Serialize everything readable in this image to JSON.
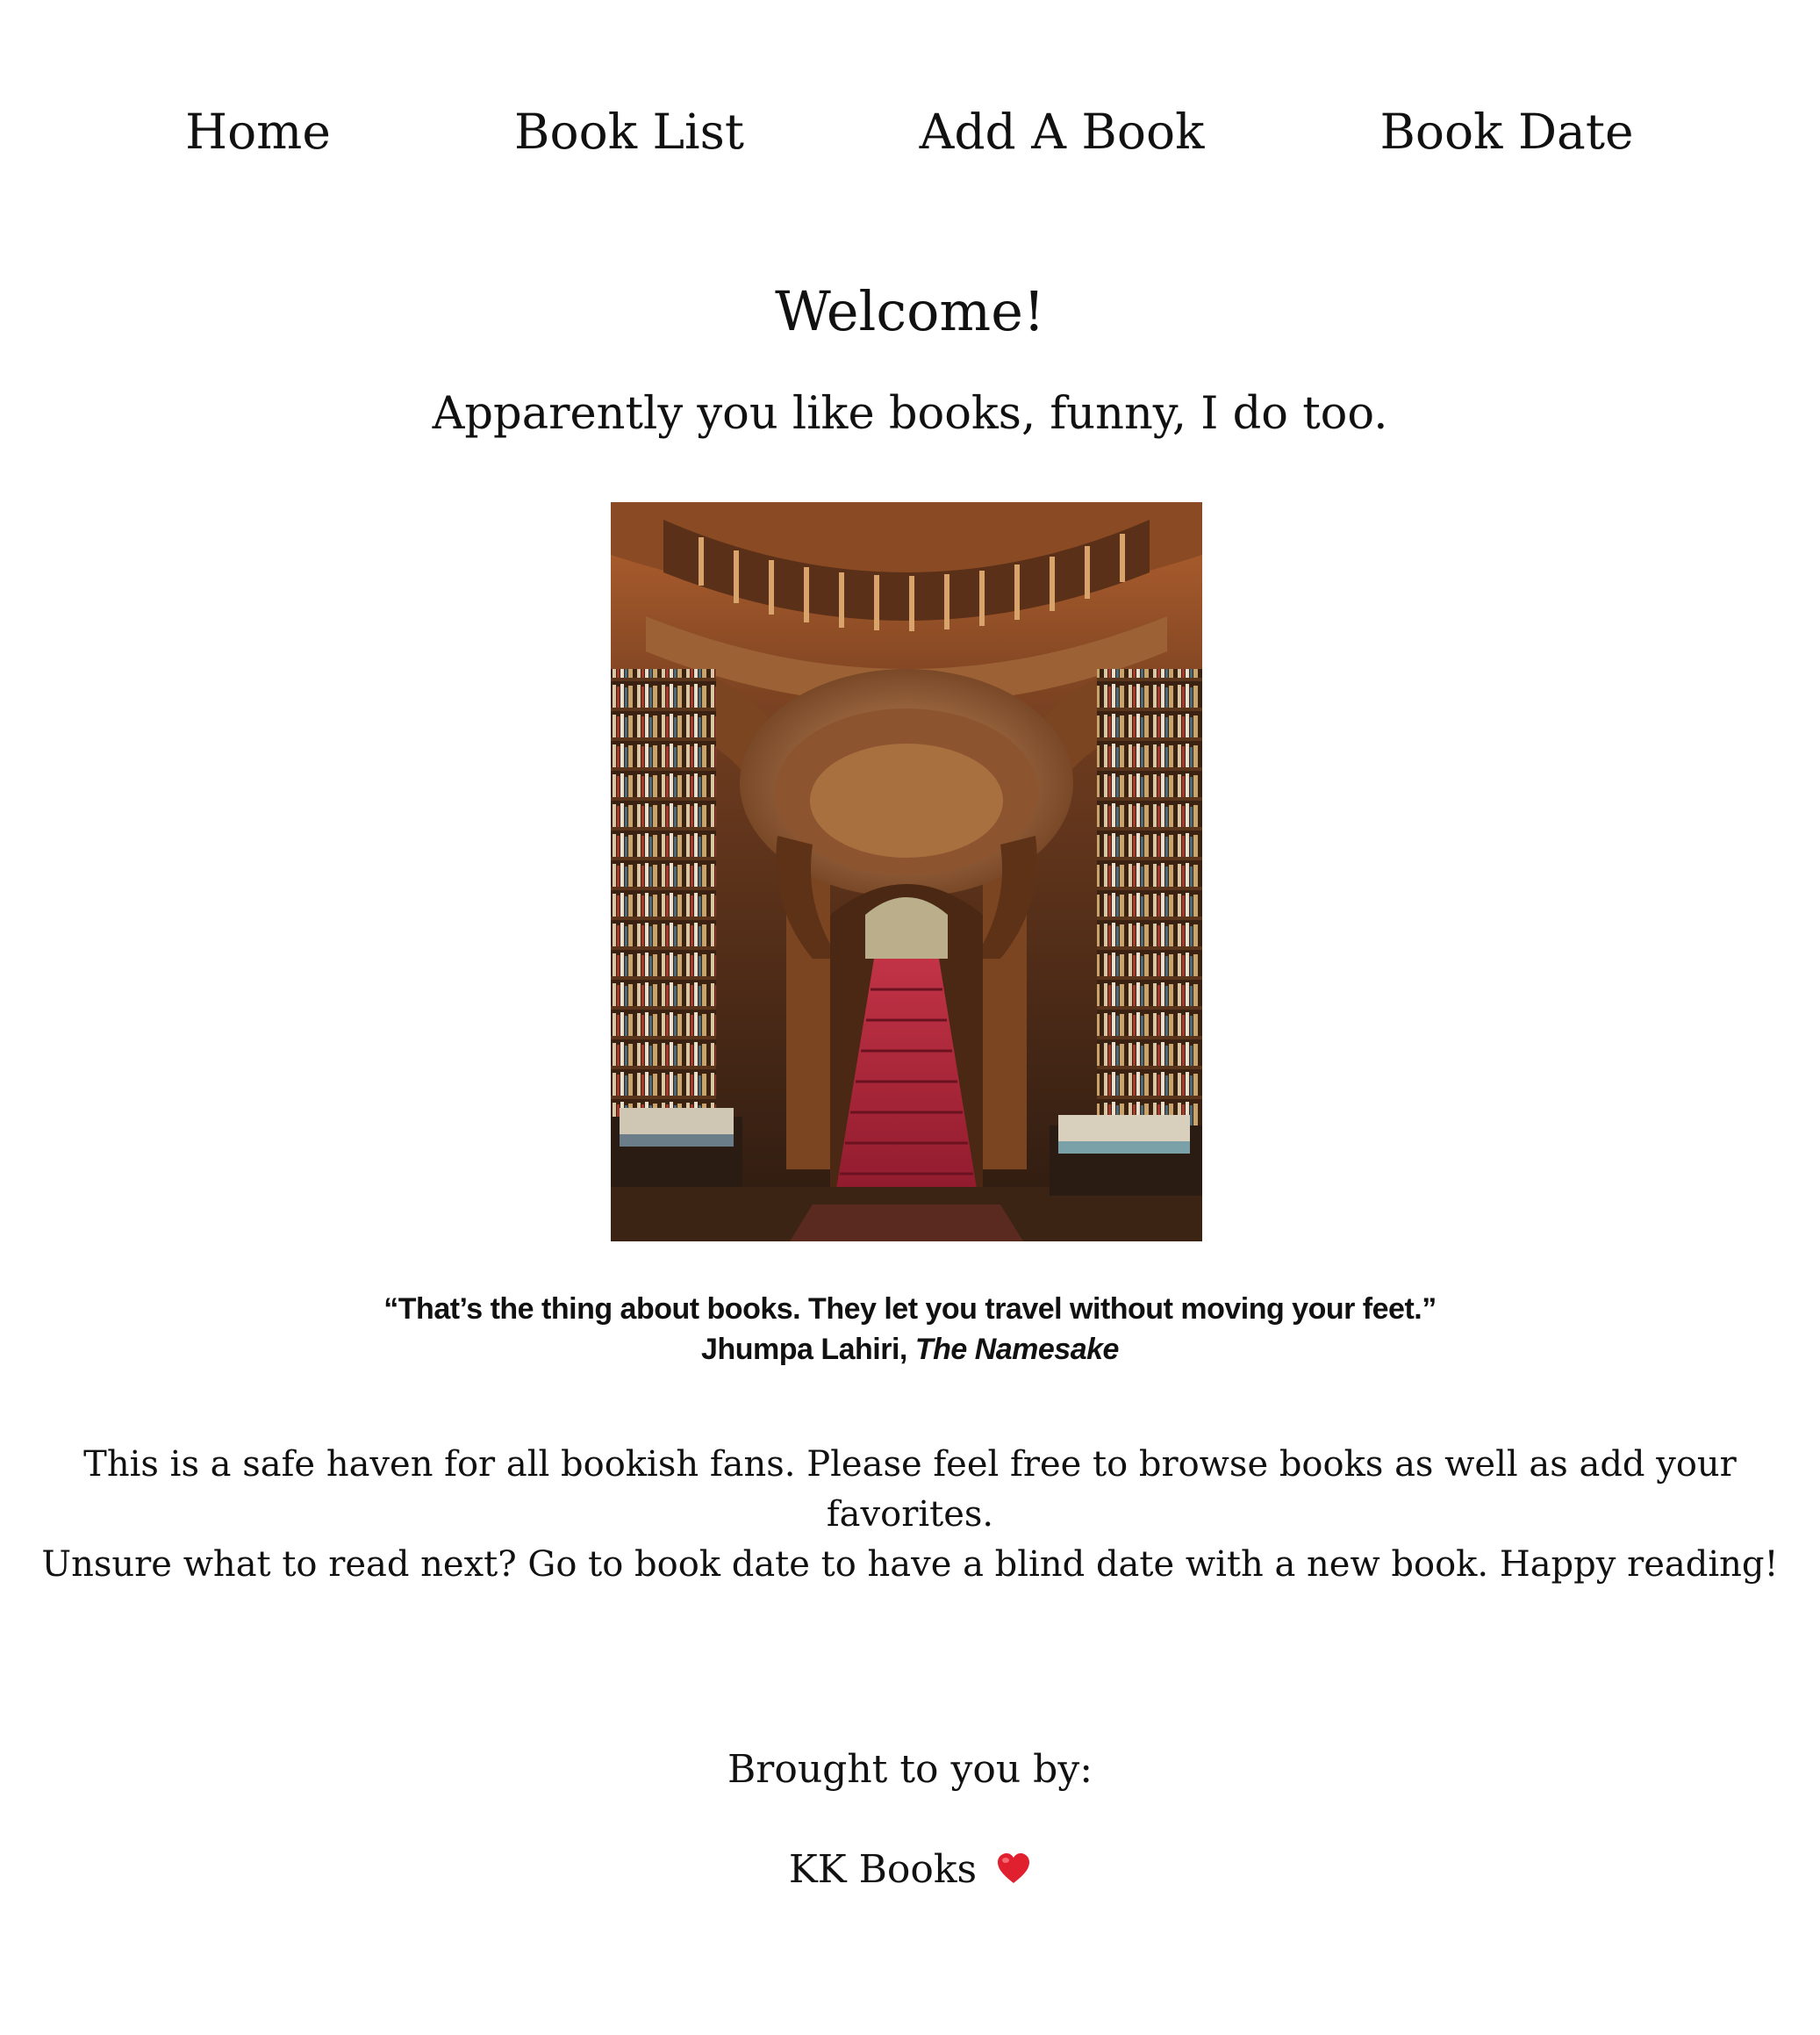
{
  "nav": {
    "items": [
      {
        "label": "Home"
      },
      {
        "label": "Book List"
      },
      {
        "label": "Add A Book"
      },
      {
        "label": "Book Date"
      }
    ]
  },
  "hero": {
    "title": "Welcome!",
    "subtitle": "Apparently you like books, funny, I do too."
  },
  "image": {
    "icon": "bookstore-staircase-photo"
  },
  "quote": {
    "text": "“That’s the thing about books. They let you travel without moving your feet.”",
    "author": "Jhumpa Lahiri,",
    "work": "The Namesake"
  },
  "intro": {
    "line1": "This is a safe haven for all bookish fans. Please feel free to browse books as well as add your favorites.",
    "line2": "Unsure what to read next? Go to book date to have a blind date with a new book. Happy reading!"
  },
  "footer": {
    "label": "Brought to you by:",
    "brand": "KK Books",
    "heart_icon": "heart-icon"
  },
  "colors": {
    "text": "#111111",
    "background": "#ffffff",
    "heart": "#e0202e",
    "stairs": "#b0243a"
  }
}
